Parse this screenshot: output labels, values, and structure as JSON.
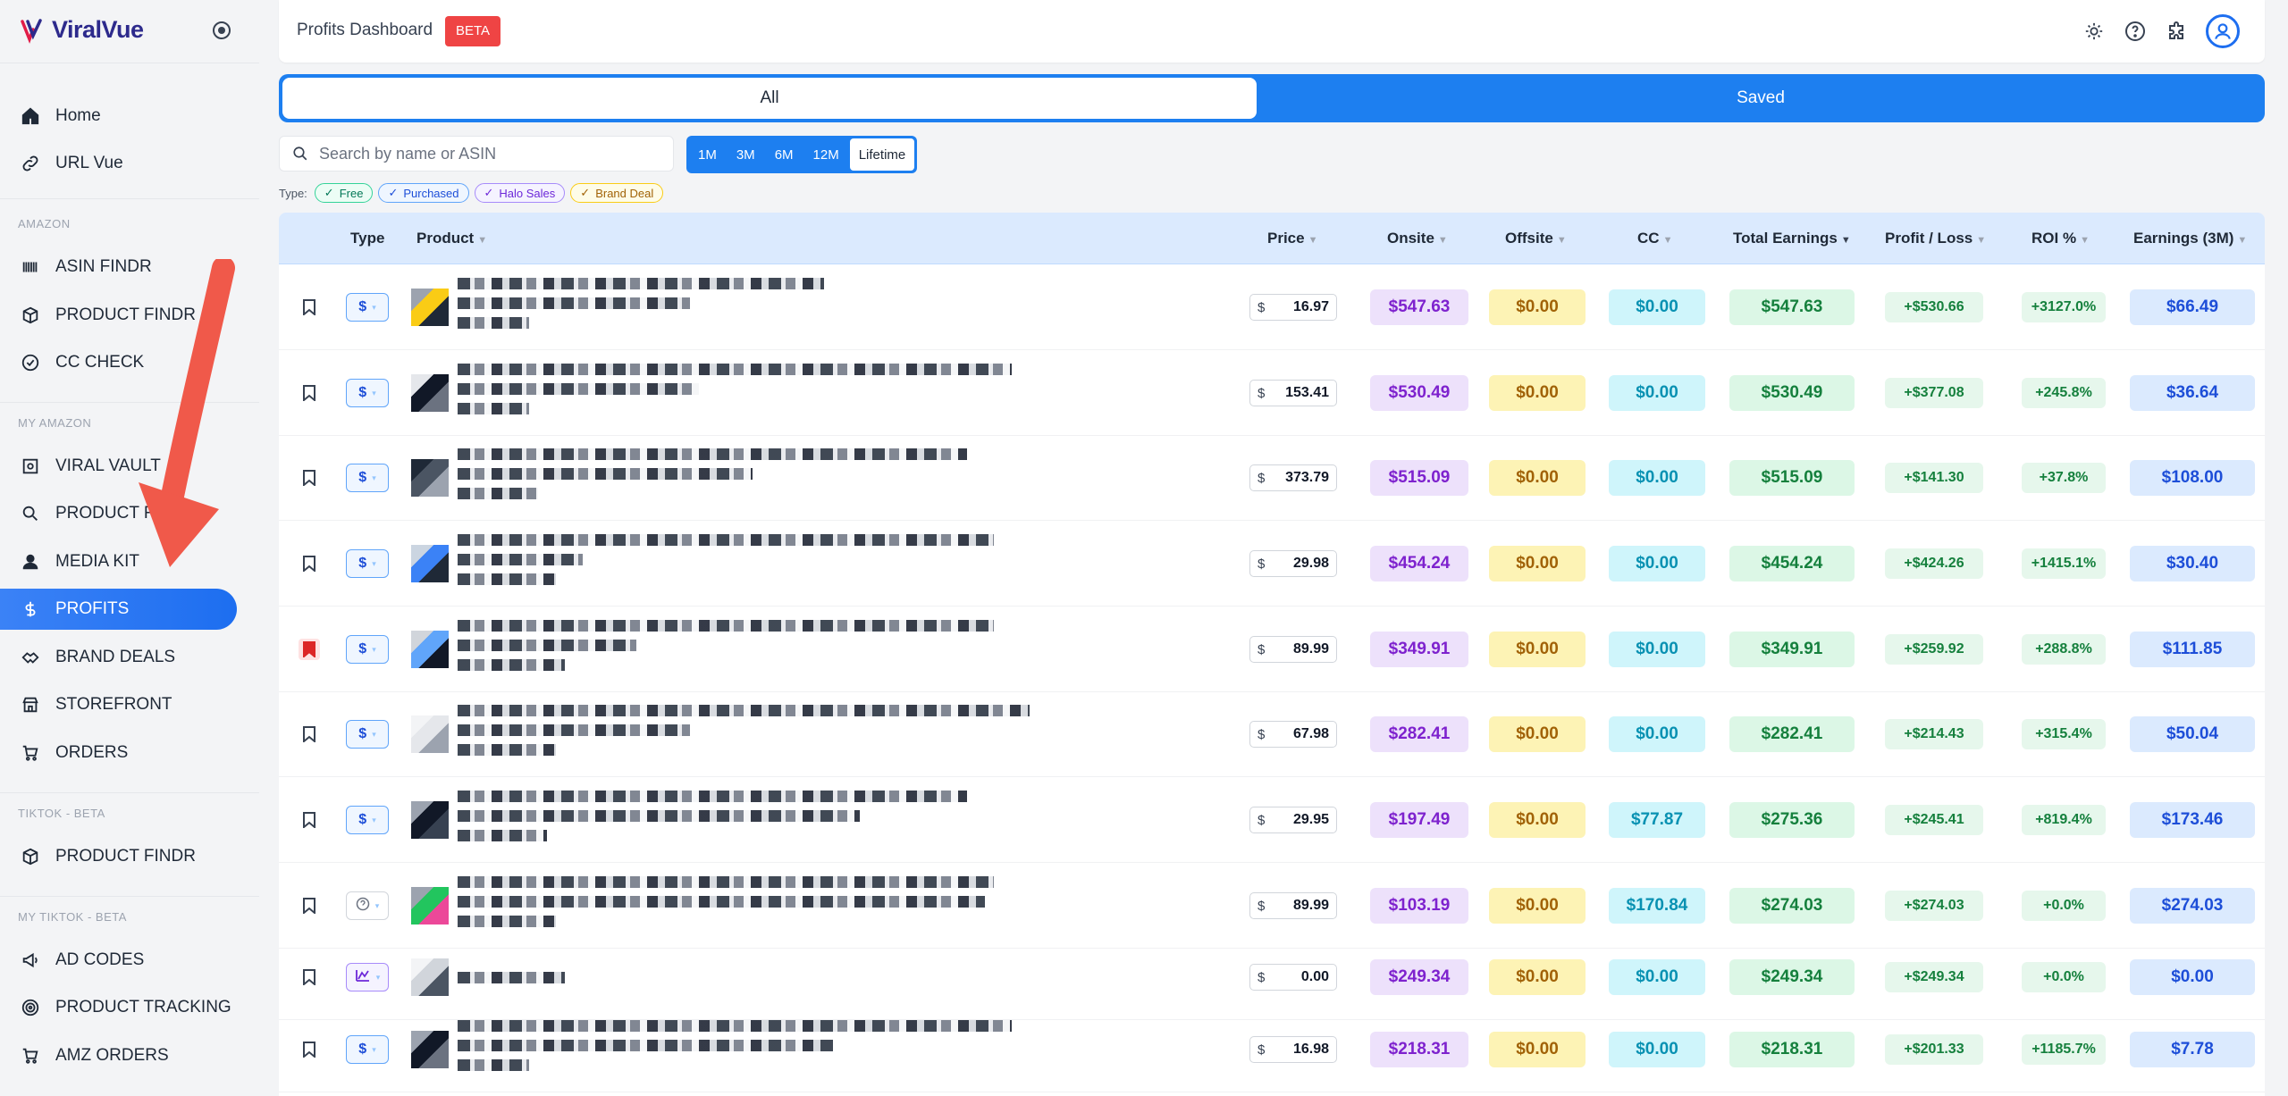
{
  "brand": {
    "logo_text": "ViralVue"
  },
  "sidebar": {
    "top_items": [
      {
        "label": "Home",
        "icon": "home-icon"
      },
      {
        "label": "URL Vue",
        "icon": "link-icon"
      }
    ],
    "sections": [
      {
        "label": "AMAZON",
        "items": [
          {
            "label": "ASIN FINDR",
            "icon": "barcode-icon"
          },
          {
            "label": "PRODUCT FINDR",
            "icon": "box-icon"
          },
          {
            "label": "CC CHECK",
            "icon": "check-badge-icon"
          }
        ]
      },
      {
        "label": "MY AMAZON",
        "items": [
          {
            "label": "VIRAL VAULT",
            "icon": "vault-icon"
          },
          {
            "label": "PRODUCT RE",
            "icon": "search-icon"
          },
          {
            "label": "MEDIA KIT",
            "icon": "user-icon"
          },
          {
            "label": "PROFITS",
            "icon": "dollar-icon",
            "active": true
          },
          {
            "label": "BRAND DEALS",
            "icon": "handshake-icon"
          },
          {
            "label": "STOREFRONT",
            "icon": "store-icon"
          },
          {
            "label": "ORDERS",
            "icon": "cart-icon"
          }
        ]
      },
      {
        "label": "TIKTOK - BETA",
        "items": [
          {
            "label": "PRODUCT FINDR",
            "icon": "box-icon"
          }
        ]
      },
      {
        "label": "MY TIKTOK - BETA",
        "items": [
          {
            "label": "AD CODES",
            "icon": "megaphone-icon"
          },
          {
            "label": "PRODUCT TRACKING",
            "icon": "target-icon"
          },
          {
            "label": "AMZ ORDERS",
            "icon": "cart-icon"
          }
        ]
      }
    ]
  },
  "header": {
    "title": "Profits Dashboard",
    "badge": "BETA"
  },
  "tabs": [
    {
      "label": "All",
      "active": true
    },
    {
      "label": "Saved"
    }
  ],
  "search": {
    "placeholder": "Search by name or ASIN"
  },
  "ranges": [
    {
      "label": "1M"
    },
    {
      "label": "3M"
    },
    {
      "label": "6M"
    },
    {
      "label": "12M"
    },
    {
      "label": "Lifetime",
      "selected": true
    }
  ],
  "type_filter": {
    "label": "Type:",
    "chips": [
      {
        "label": "Free"
      },
      {
        "label": "Purchased"
      },
      {
        "label": "Halo Sales"
      },
      {
        "label": "Brand Deal"
      }
    ]
  },
  "table": {
    "columns": {
      "type": "Type",
      "product": "Product",
      "price": "Price",
      "onsite": "Onsite",
      "offsite": "Offsite",
      "cc": "CC",
      "total": "Total Earnings",
      "pl": "Profit / Loss",
      "roi": "ROI %",
      "earn3m": "Earnings (3M)"
    },
    "currency_symbol": "$",
    "rows": [
      {
        "saved": false,
        "type": "purchased",
        "price": "16.97",
        "onsite": "$547.63",
        "offsite": "$0.00",
        "cc": "$0.00",
        "total": "$547.63",
        "pl": "+$530.66",
        "roi": "+3127.0%",
        "earn3m": "$66.49"
      },
      {
        "saved": false,
        "type": "purchased",
        "price": "153.41",
        "onsite": "$530.49",
        "offsite": "$0.00",
        "cc": "$0.00",
        "total": "$530.49",
        "pl": "+$377.08",
        "roi": "+245.8%",
        "earn3m": "$36.64"
      },
      {
        "saved": false,
        "type": "purchased",
        "price": "373.79",
        "onsite": "$515.09",
        "offsite": "$0.00",
        "cc": "$0.00",
        "total": "$515.09",
        "pl": "+$141.30",
        "roi": "+37.8%",
        "earn3m": "$108.00"
      },
      {
        "saved": false,
        "type": "purchased",
        "price": "29.98",
        "onsite": "$454.24",
        "offsite": "$0.00",
        "cc": "$0.00",
        "total": "$454.24",
        "pl": "+$424.26",
        "roi": "+1415.1%",
        "earn3m": "$30.40"
      },
      {
        "saved": true,
        "type": "purchased",
        "price": "89.99",
        "onsite": "$349.91",
        "offsite": "$0.00",
        "cc": "$0.00",
        "total": "$349.91",
        "pl": "+$259.92",
        "roi": "+288.8%",
        "earn3m": "$111.85"
      },
      {
        "saved": false,
        "type": "purchased",
        "price": "67.98",
        "onsite": "$282.41",
        "offsite": "$0.00",
        "cc": "$0.00",
        "total": "$282.41",
        "pl": "+$214.43",
        "roi": "+315.4%",
        "earn3m": "$50.04"
      },
      {
        "saved": false,
        "type": "purchased",
        "price": "29.95",
        "onsite": "$197.49",
        "offsite": "$0.00",
        "cc": "$77.87",
        "total": "$275.36",
        "pl": "+$245.41",
        "roi": "+819.4%",
        "earn3m": "$173.46"
      },
      {
        "saved": false,
        "type": "unknown",
        "price": "89.99",
        "onsite": "$103.19",
        "offsite": "$0.00",
        "cc": "$170.84",
        "total": "$274.03",
        "pl": "+$274.03",
        "roi": "+0.0%",
        "earn3m": "$274.03"
      },
      {
        "saved": false,
        "type": "halo",
        "price": "0.00",
        "onsite": "$249.34",
        "offsite": "$0.00",
        "cc": "$0.00",
        "total": "$249.34",
        "pl": "+$249.34",
        "roi": "+0.0%",
        "earn3m": "$0.00"
      },
      {
        "saved": false,
        "type": "purchased",
        "price": "16.98",
        "onsite": "$218.31",
        "offsite": "$0.00",
        "cc": "$0.00",
        "total": "$218.31",
        "pl": "+$201.33",
        "roi": "+1185.7%",
        "earn3m": "$7.78"
      }
    ]
  },
  "colors": {
    "accent": "#1d7ff0",
    "beta": "#ef4444",
    "onsite": "#7e22ce",
    "offsite": "#a16207",
    "cc": "#0891b2",
    "total": "#15803d",
    "earnings": "#1d4ed8"
  }
}
